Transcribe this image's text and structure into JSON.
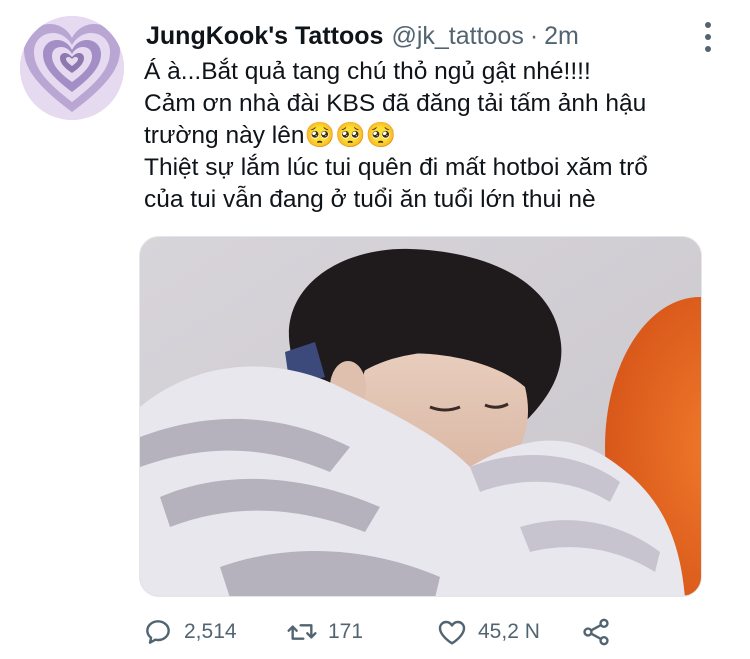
{
  "tweet": {
    "author_name": "JungKook's Tattoos",
    "handle": "@jk_tattoos",
    "separator": "·",
    "time": "2m",
    "lines": [
      "Á à...Bắt quả tang chú thỏ ngủ gật nhé!!!!",
      "Cảm ơn nhà đài KBS đã đăng tải tấm ảnh hậu",
      "trường này lên🥺🥺🥺",
      "Thiệt sự lắm lúc tui quên đi mất hotboi xăm trổ",
      "của tui vẫn đang ở tuổi ăn tuổi lớn thui nè"
    ]
  },
  "actions": {
    "reply": {
      "icon": "reply-icon",
      "count": "2,514"
    },
    "retweet": {
      "icon": "retweet-icon",
      "count": "171"
    },
    "like": {
      "icon": "heart-icon",
      "count": "45,2 N"
    },
    "share": {
      "icon": "share-icon"
    }
  },
  "colors": {
    "text": "#0f1419",
    "secondary": "#536471",
    "avatar_bg": "#e3d6ef",
    "avatar_heart": "#8e78b0"
  }
}
